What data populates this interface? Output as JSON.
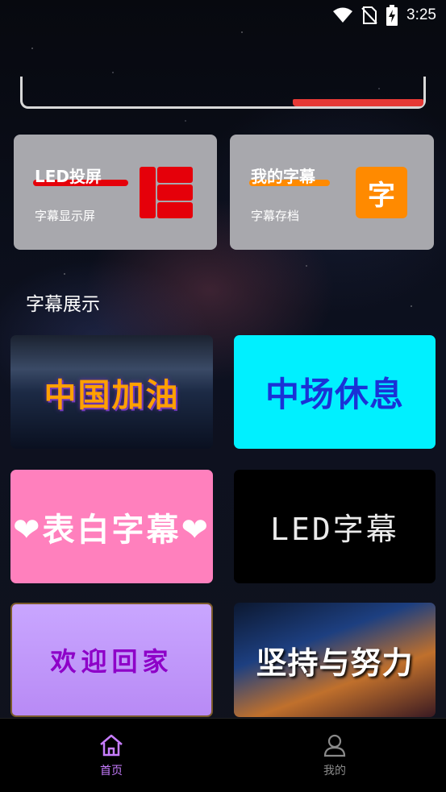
{
  "status_bar": {
    "time": "3:25",
    "icons": [
      "wifi-icon",
      "no-sim-icon",
      "battery-charging-icon"
    ]
  },
  "features": [
    {
      "title": "LED投屏",
      "subtitle": "字幕显示屏",
      "icon": "grid-icon",
      "accent": "#e5000a"
    },
    {
      "title": "我的字幕",
      "subtitle": "字幕存档",
      "icon_text": "字",
      "icon": "zi-icon",
      "accent": "#ff8a00"
    }
  ],
  "section_title": "字幕展示",
  "subtitles": [
    {
      "text": "中国加油"
    },
    {
      "text": "中场休息"
    },
    {
      "text": "❤表白字幕❤"
    },
    {
      "text": "LED字幕"
    },
    {
      "text": "欢迎回家"
    },
    {
      "text": "坚持与努力"
    }
  ],
  "bottom_nav": {
    "home_label": "首页",
    "mine_label": "我的",
    "active": "home",
    "active_color": "#c77dff"
  }
}
